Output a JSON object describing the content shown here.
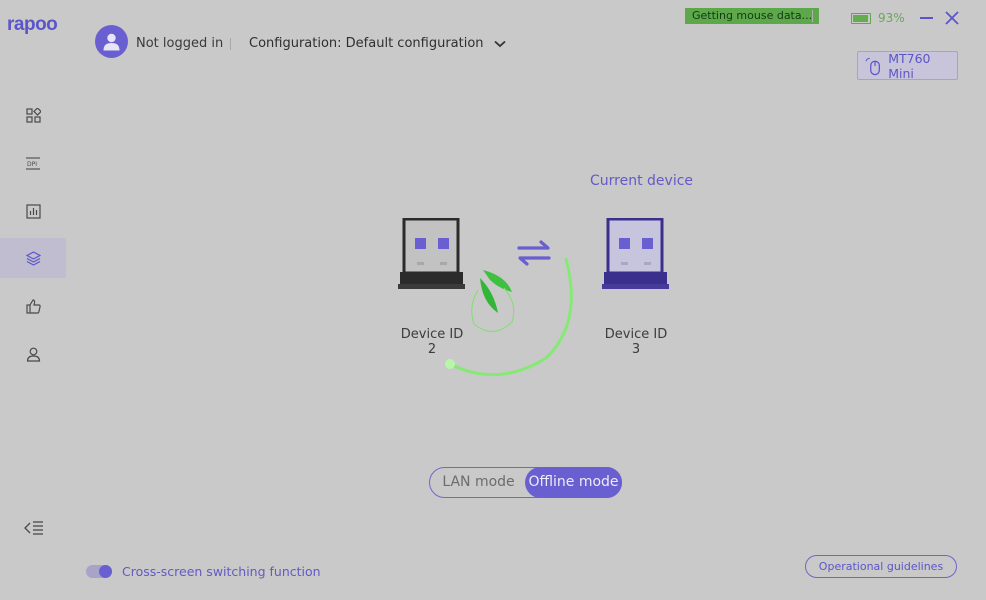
{
  "app": {
    "logo": "rapoo"
  },
  "header": {
    "login_status": "Not logged in",
    "configuration_label": "Configuration: Default configuration",
    "status_badge": "Getting mouse data...",
    "battery_percent": "93%",
    "battery_level": 0.93,
    "device_name": "MT760 Mini"
  },
  "sidebar": {
    "items": [
      {
        "icon": "grid-icon",
        "active": false
      },
      {
        "icon": "dpi-icon",
        "active": false
      },
      {
        "icon": "bar-chart-icon",
        "active": false
      },
      {
        "icon": "layers-icon",
        "active": true
      },
      {
        "icon": "thumbs-up-icon",
        "active": false
      },
      {
        "icon": "user-icon",
        "active": false
      }
    ]
  },
  "main": {
    "current_device_label": "Current device",
    "device_left": "Device ID 2",
    "device_right": "Device ID 3",
    "mode": {
      "lan": "LAN mode",
      "offline": "Offline mode",
      "selected": "offline"
    }
  },
  "footer": {
    "cross_screen_label": "Cross-screen switching function",
    "cross_screen_enabled": true,
    "guidelines_button": "Operational guidelines"
  },
  "colors": {
    "accent": "#6a5fd0",
    "status_green": "#5ca84a",
    "background": "#c9c9c9"
  }
}
